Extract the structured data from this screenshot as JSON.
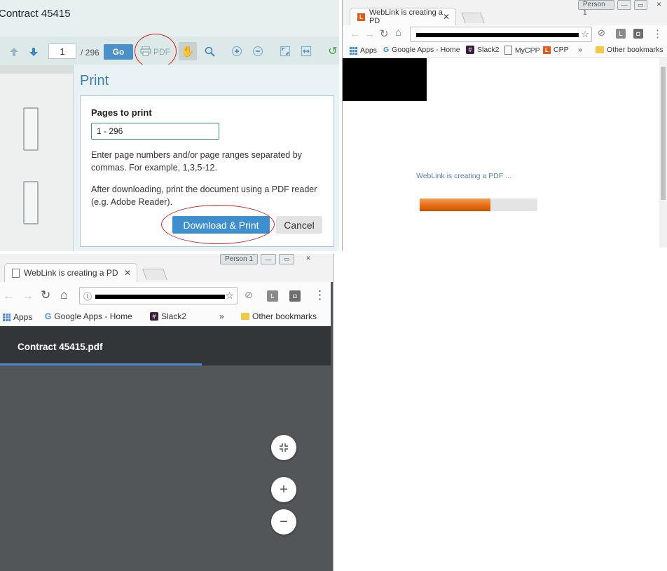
{
  "viewer": {
    "document_title": "Contract 45415",
    "toolbar": {
      "page_number": "1",
      "page_total": "/ 296",
      "go_label": "Go",
      "pdf_label": "PDF"
    },
    "print_dialog": {
      "title": "Print",
      "pages_label": "Pages to print",
      "pages_value": "1 - 296",
      "help_ranges": "Enter page numbers and/or page ranges separated by commas. For example, 1,3,5-12.",
      "help_reader": "After downloading, print the document using a PDF reader (e.g. Adobe Reader).",
      "download_label": "Download & Print",
      "cancel_label": "Cancel"
    },
    "highlight_color": "#d42020"
  },
  "browser_loading": {
    "profile_label": "Person 1",
    "tab_title": "WebLink is creating a PD",
    "bookmarks": [
      "Apps",
      "Google Apps - Home",
      "Slack2",
      "MyCPP",
      "CPP"
    ],
    "overflow": "»",
    "other_bookmarks": "Other bookmarks",
    "status_text": "WebLink is creating a PDF ...",
    "progress": 0.6,
    "progress_color": "#e46a10"
  },
  "browser_pdf": {
    "profile_label": "Person 1",
    "tab_title": "WebLink is creating a PD",
    "bookmarks": [
      "Apps",
      "Google Apps - Home",
      "Slack2"
    ],
    "overflow": "»",
    "other_bookmarks": "Other bookmarks",
    "pdf_filename": "Contract 45415.pdf",
    "load_progress": 0.61,
    "accent_color": "#4a86d1"
  },
  "icons": {
    "nav_up": "arrow-up-icon",
    "nav_down": "arrow-down-icon",
    "printer": "printer-icon",
    "hand": "hand-icon",
    "zoom": "zoom-icon",
    "zoom_in": "zoom-in-icon",
    "zoom_out": "zoom-out-icon",
    "fit_page": "fit-page-icon",
    "fit_width": "fit-width-icon",
    "rotate": "rotate-icon",
    "fit_to_page": "fit-to-page-icon",
    "plus": "plus-icon",
    "minus": "minus-icon"
  }
}
